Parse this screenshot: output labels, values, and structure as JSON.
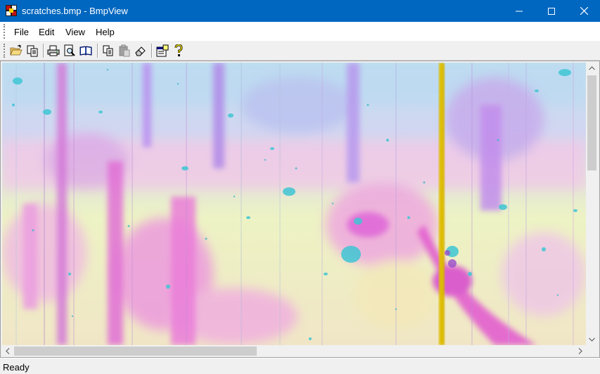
{
  "window": {
    "title": "scratches.bmp - BmpView",
    "app_icon": "bmpview-app-icon",
    "accent": "#0067c0",
    "controls": [
      "minimize-icon",
      "maximize-icon",
      "close-icon"
    ]
  },
  "menubar": {
    "items": [
      {
        "label": "File"
      },
      {
        "label": "Edit"
      },
      {
        "label": "View"
      },
      {
        "label": "Help"
      }
    ]
  },
  "toolbar": {
    "buttons": [
      {
        "icon": "open-folder-icon",
        "tooltip": ""
      },
      {
        "icon": "copy-pages-icon",
        "tooltip": ""
      },
      {
        "icon": "printer-icon",
        "tooltip": ""
      },
      {
        "icon": "print-preview-icon",
        "tooltip": ""
      },
      {
        "icon": "book-icon",
        "tooltip": ""
      },
      {
        "icon": "copy-icon",
        "tooltip": ""
      },
      {
        "icon": "paste-icon",
        "tooltip": ""
      },
      {
        "icon": "eraser-icon",
        "tooltip": ""
      },
      {
        "icon": "properties-icon",
        "tooltip": ""
      },
      {
        "icon": "help-question-icon",
        "tooltip": ""
      }
    ]
  },
  "document": {
    "image_name": "scratches.bmp",
    "palette": {
      "pink": "#e86fd0",
      "violet": "#b48be8",
      "cyan": "#5fd6d6",
      "yellow": "#f1f3b6",
      "gold": "#d9b600"
    }
  },
  "scrollbars": {
    "vertical": {
      "position": 0.0
    },
    "horizontal": {
      "position": 0.0
    }
  },
  "statusbar": {
    "text": "Ready"
  }
}
